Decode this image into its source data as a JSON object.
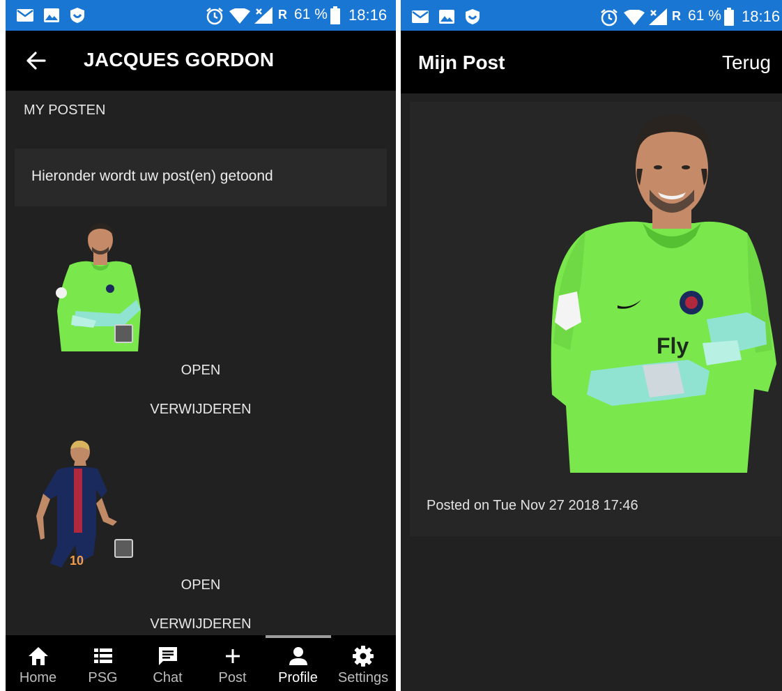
{
  "status_bar": {
    "battery": "61 %",
    "network_label": "R",
    "time": "18:16"
  },
  "left": {
    "header": {
      "title": "JACQUES GORDON"
    },
    "section_title": "MY POSTEN",
    "info_text": "Hieronder wordt uw post(en) getoond",
    "posts": [
      {
        "open_label": "OPEN",
        "delete_label": "VERWIJDEREN"
      },
      {
        "open_label": "OPEN",
        "delete_label": "VERWIJDEREN"
      }
    ],
    "nav": [
      {
        "label": "Home",
        "icon": "home-icon"
      },
      {
        "label": "PSG",
        "icon": "list-icon"
      },
      {
        "label": "Chat",
        "icon": "chat-icon"
      },
      {
        "label": "Post",
        "icon": "plus-icon"
      },
      {
        "label": "Profile",
        "icon": "person-icon",
        "active": true
      },
      {
        "label": "Settings",
        "icon": "gear-icon"
      }
    ]
  },
  "right": {
    "header": {
      "title": "Mijn Post",
      "back_label": "Terug"
    },
    "posted_on": "Posted on Tue Nov 27 2018 17:46"
  },
  "colors": {
    "status_bar": "#1976d2",
    "app_bar": "#000000",
    "background": "#212121",
    "card": "#292929",
    "jersey_green": "#7ae84d",
    "jersey_navy": "#1b2a5c"
  }
}
